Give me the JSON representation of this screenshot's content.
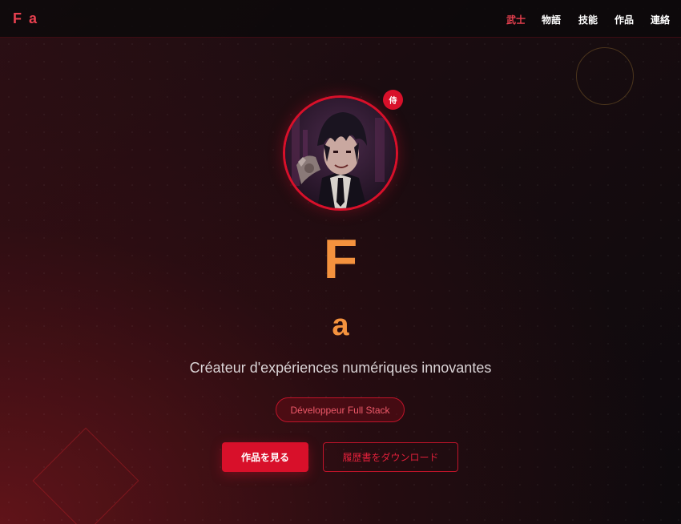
{
  "header": {
    "logo": "F a",
    "nav": [
      "武士",
      "物語",
      "技能",
      "作品",
      "連絡"
    ]
  },
  "hero": {
    "badge": "侍",
    "name_main": "F",
    "name_sub": "a",
    "tagline": "Créateur d'expériences numériques innovantes",
    "role": "Développeur Full Stack",
    "primary_button": "作品を見る",
    "secondary_button": "履歴書をダウンロード"
  },
  "colors": {
    "accent": "#d8102a",
    "name": "#f4923e",
    "logo": "#e8404f"
  }
}
